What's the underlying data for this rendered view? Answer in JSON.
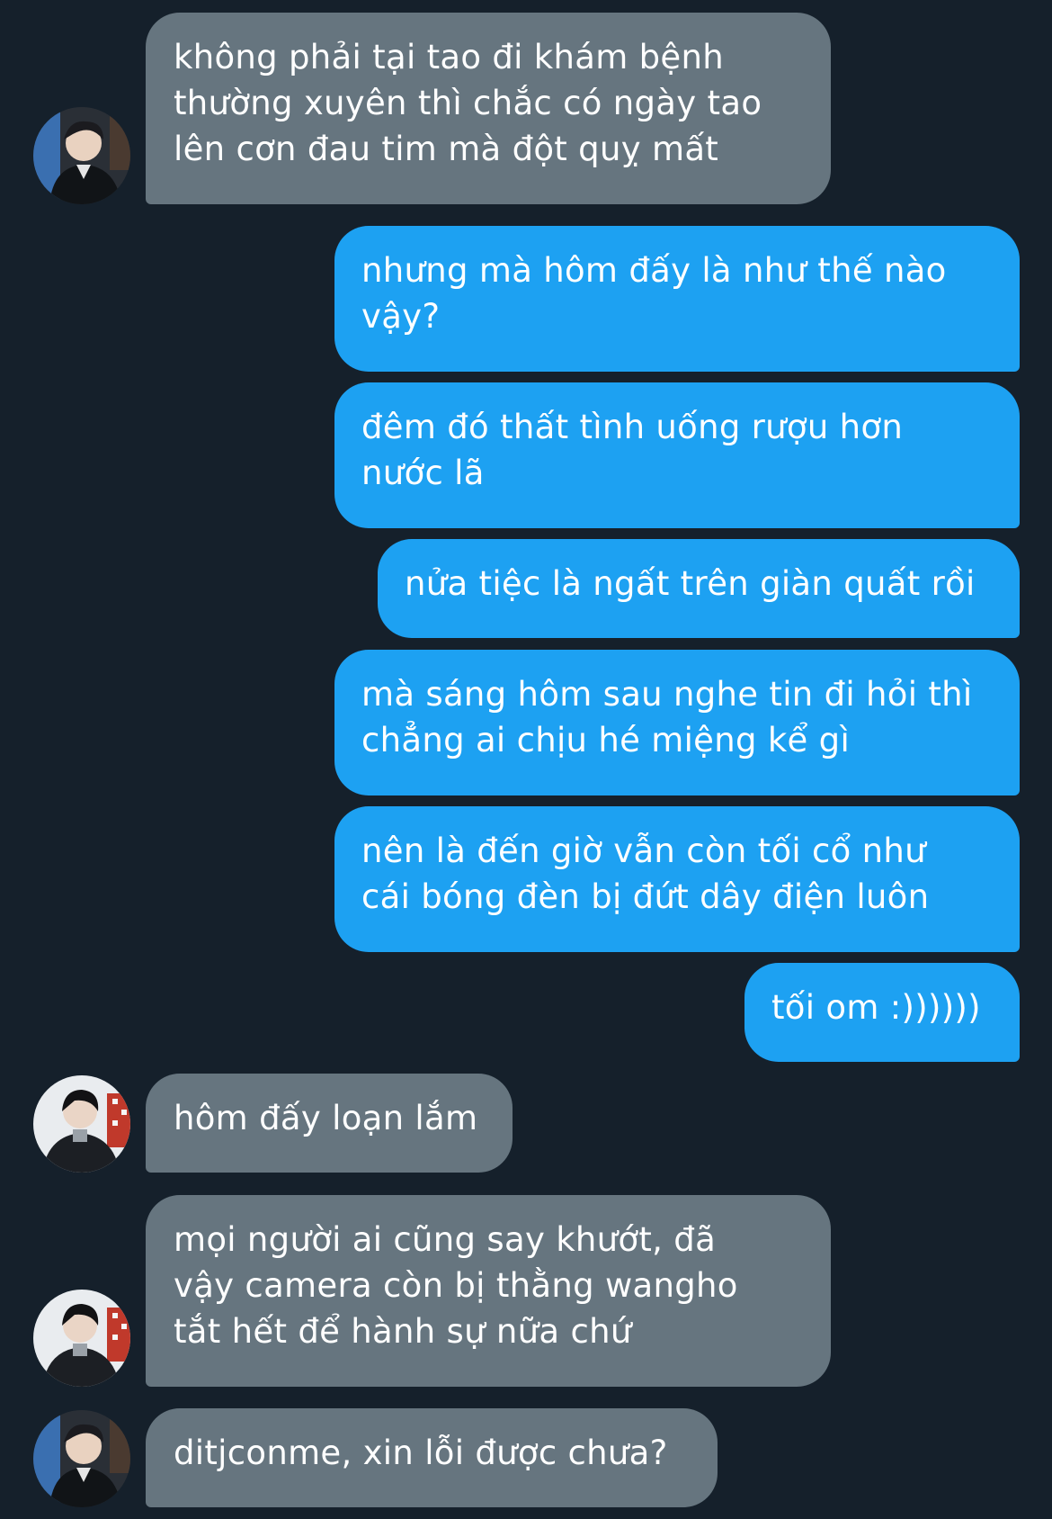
{
  "theme": {
    "background": "#15202b",
    "incoming_bubble": "#66757f",
    "outgoing_bubble": "#1da1f2",
    "text": "#ffffff"
  },
  "messages": [
    {
      "from": "them",
      "avatar": "user-avatar-a",
      "text": "không phải tại tao đi khám bệnh\nthường xuyên thì chắc có ngày tao\nlên cơn đau tim mà đột quỵ mất"
    },
    {
      "from": "me",
      "text": "nhưng mà hôm đấy là như thế nào\nvậy?"
    },
    {
      "from": "me",
      "text": "đêm đó thất tình uống rượu hơn\nnước lã"
    },
    {
      "from": "me",
      "text": "nửa tiệc là ngất trên giàn quất rồi"
    },
    {
      "from": "me",
      "text": "mà sáng hôm sau nghe tin đi hỏi thì\nchẳng ai chịu hé miệng kể gì"
    },
    {
      "from": "me",
      "text": "nên là đến giờ vẫn còn tối cổ như\ncái bóng đèn bị đứt dây điện luôn"
    },
    {
      "from": "me",
      "text": "tối om :))))))"
    },
    {
      "from": "them",
      "avatar": "user-avatar-b",
      "text": "hôm đấy loạn lắm"
    },
    {
      "from": "them",
      "avatar": "user-avatar-b",
      "text": "mọi người ai cũng say khướt, đã\nvậy camera còn bị thằng wangho\ntắt hết để hành sự nữa chứ"
    },
    {
      "from": "them",
      "avatar": "user-avatar-a",
      "text": "ditjconme, xin lỗi được chưa?"
    }
  ]
}
